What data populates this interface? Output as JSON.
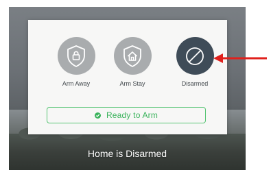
{
  "modes": {
    "arm_away": {
      "label": "Arm Away",
      "icon": "lock-shield-icon"
    },
    "arm_stay": {
      "label": "Arm Stay",
      "icon": "house-shield-icon"
    },
    "disarmed": {
      "label": "Disarmed",
      "icon": "slash-circle-icon",
      "selected": true
    }
  },
  "ready": {
    "label": "Ready to Arm",
    "icon": "check-circle-icon"
  },
  "status": {
    "text": "Home is Disarmed"
  },
  "colors": {
    "mode_inactive": "#a9acae",
    "mode_selected": "#3f4c58",
    "ready_green": "#3bb35c",
    "annotation_arrow": "#e0201c"
  }
}
